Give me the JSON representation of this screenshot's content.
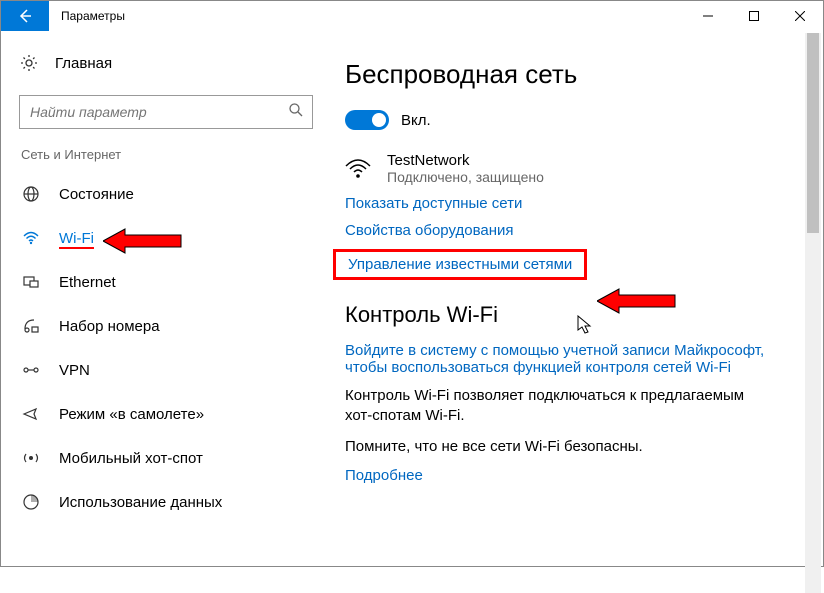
{
  "window": {
    "title": "Параметры"
  },
  "sidebar": {
    "home_label": "Главная",
    "search_placeholder": "Найти параметр",
    "section_label": "Сеть и Интернет",
    "items": [
      {
        "label": "Состояние"
      },
      {
        "label": "Wi-Fi"
      },
      {
        "label": "Ethernet"
      },
      {
        "label": "Набор номера"
      },
      {
        "label": "VPN"
      },
      {
        "label": "Режим «в самолете»"
      },
      {
        "label": "Мобильный хот-спот"
      },
      {
        "label": "Использование данных"
      }
    ]
  },
  "content": {
    "heading": "Беспроводная сеть",
    "toggle_label": "Вкл.",
    "network": {
      "name": "TestNetwork",
      "status": "Подключено, защищено"
    },
    "link_show_available": "Показать доступные сети",
    "link_hardware": "Свойства оборудования",
    "link_manage_known": "Управление известными сетями",
    "heading_wifi_control": "Контроль Wi-Fi",
    "link_signin": "Войдите в систему с помощью учетной записи Майкрософт, чтобы воспользоваться функцией контроля сетей Wi-Fi",
    "para_hotspots": "Контроль Wi-Fi позволяет подключаться к предлагаемым хот-спотам Wi-Fi.",
    "para_safety": "Помните, что не все сети Wi-Fi безопасны.",
    "link_more": "Подробнее"
  }
}
